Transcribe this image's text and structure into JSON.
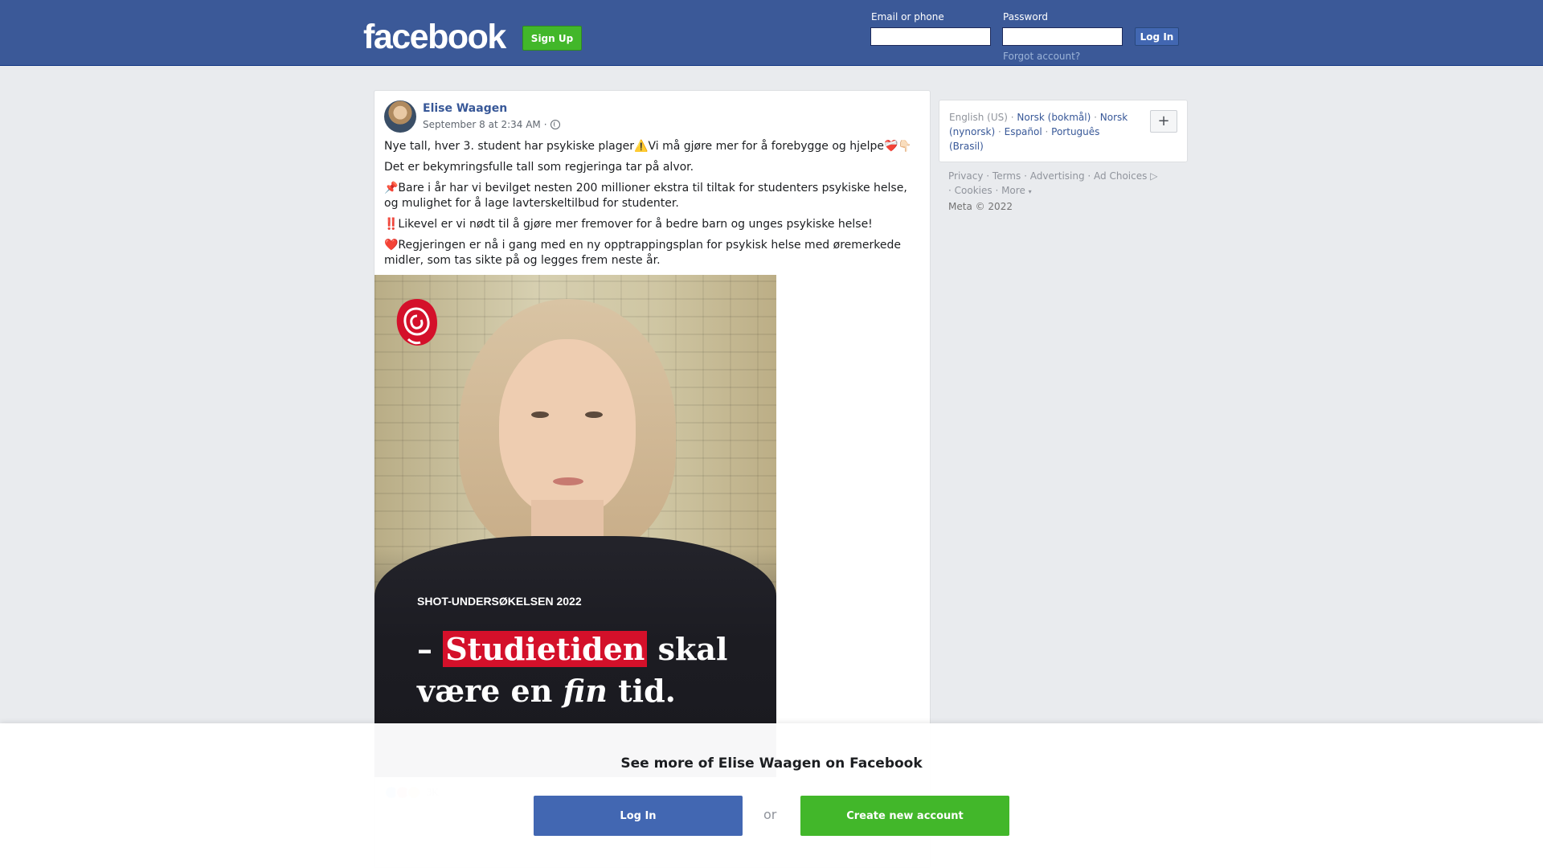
{
  "header": {
    "logo": "facebook",
    "signup_label": "Sign Up",
    "email_label": "Email or phone",
    "password_label": "Password",
    "login_label": "Log In",
    "forgot_label": "Forgot account?"
  },
  "post": {
    "author": "Elise Waagen",
    "timestamp": "September 8 at 2:34 AM",
    "privacy_separator": "·",
    "paragraphs": [
      "Nye tall, hver 3. student har psykiske plager⚠️Vi må gjøre mer for å forebygge og hjelpe❤️‍🩹👇🏻",
      "Det er bekymringsfulle tall som regjeringa tar på alvor.",
      "📌Bare i år har vi bevilget nesten 200 millioner ekstra til tiltak for studenters psykiske helse, og mulighet for å lage lavterskeltilbud for studenter.",
      "‼️Likevel er vi nødt til å gjøre mer fremover for å bedre barn og unges psykiske helse!",
      "❤️Regjeringen er nå i gang med en ny opptrappingsplan for psykisk helse med øremerkede midler, som tas sikte på og legges frem neste år."
    ],
    "image": {
      "survey_label": "SHOT-UNDERSØKELSEN 2022",
      "quote_dash": "– ",
      "quote_highlight": "Studietiden",
      "quote_rest1": " skal",
      "quote_line2_a": "være en ",
      "quote_line2_em": "fin",
      "quote_line2_b": " tid."
    },
    "reaction_count": "3K"
  },
  "languages": {
    "current": "English (US)",
    "links": [
      "Norsk (bokmål)",
      "Norsk (nynorsk)",
      "Español",
      "Português (Brasil)"
    ],
    "plus": "+"
  },
  "footer": {
    "links": [
      "Privacy",
      "Terms",
      "Advertising",
      "Ad Choices",
      "Cookies",
      "More"
    ],
    "copyright": "Meta © 2022"
  },
  "bottom_bar": {
    "title": "See more of Elise Waagen on Facebook",
    "login_label": "Log In",
    "or_label": "or",
    "create_label": "Create new account"
  },
  "colors": {
    "header_bg": "#3b5998",
    "link": "#385898",
    "signup_green": "#42b72a",
    "login_blue": "#4267b2",
    "highlight_red": "#d4102a"
  }
}
